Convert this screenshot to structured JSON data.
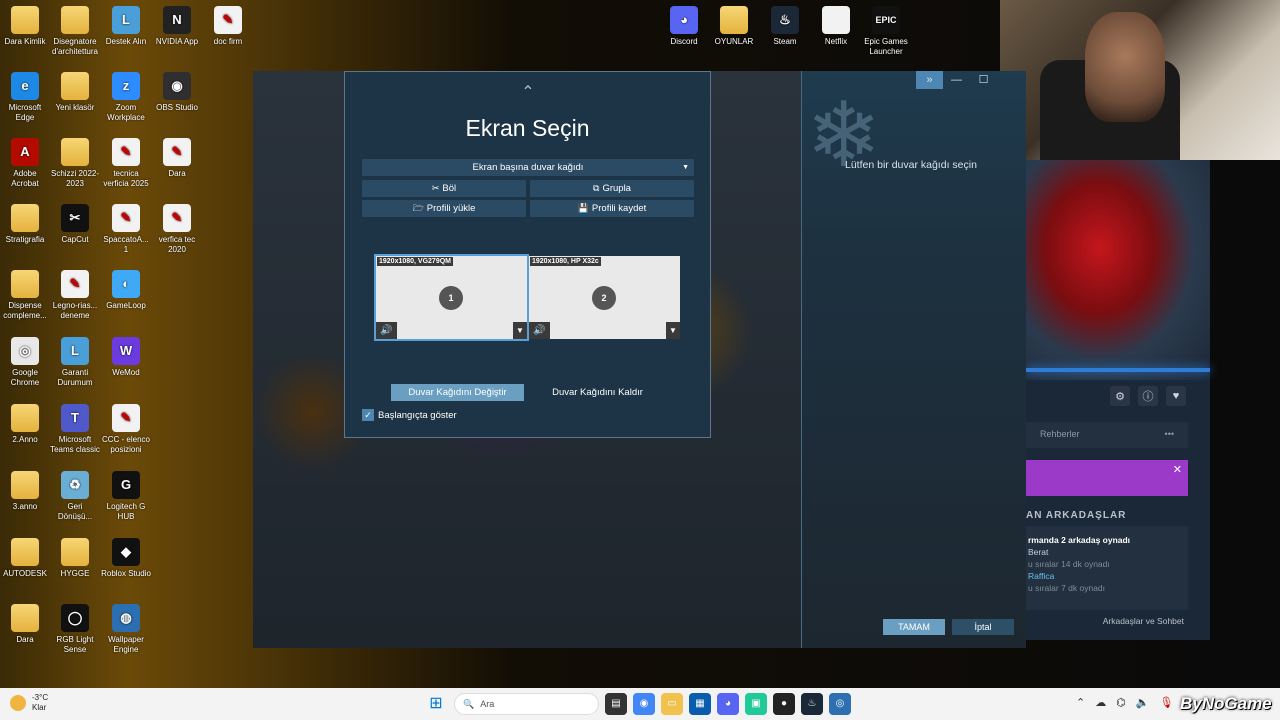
{
  "desktop_icons_left": [
    {
      "label": "Dara Kimlik",
      "icon": "folder-icon",
      "kind": "folder"
    },
    {
      "label": "Disegnatore d'architettura",
      "icon": "folder-icon",
      "kind": "folder"
    },
    {
      "label": "Destek Alın",
      "icon": "support-icon",
      "kind": "app"
    },
    {
      "label": "NVIDIA App",
      "icon": "nvidia-icon",
      "kind": "app"
    },
    {
      "label": "doc firm",
      "icon": "pdf-icon",
      "kind": "pdf"
    },
    {
      "label": "Microsoft Edge",
      "icon": "edge-icon",
      "kind": "app"
    },
    {
      "label": "Yeni klasör",
      "icon": "folder-icon",
      "kind": "folder"
    },
    {
      "label": "Zoom Workplace",
      "icon": "zoom-icon",
      "kind": "app"
    },
    {
      "label": "OBS Studio",
      "icon": "obs-icon",
      "kind": "app"
    },
    {
      "label": "Adobe Acrobat",
      "icon": "acrobat-icon",
      "kind": "app"
    },
    {
      "label": "Schizzi 2022-2023",
      "icon": "folder-icon",
      "kind": "folder"
    },
    {
      "label": "tecnica verficia 2025",
      "icon": "pdf-icon",
      "kind": "pdf"
    },
    {
      "label": "Dara",
      "icon": "pdf-icon",
      "kind": "pdf"
    },
    {
      "label": "Stratigrafia",
      "icon": "folder-icon",
      "kind": "folder"
    },
    {
      "label": "CapCut",
      "icon": "capcut-icon",
      "kind": "app"
    },
    {
      "label": "SpaccatoA... 1",
      "icon": "pdf-icon",
      "kind": "pdf"
    },
    {
      "label": "verfica tec 2020",
      "icon": "pdf-icon",
      "kind": "pdf"
    },
    {
      "label": "Dispense compleme...",
      "icon": "folder-icon",
      "kind": "folder"
    },
    {
      "label": "Legno-rias... deneme",
      "icon": "pdf-icon",
      "kind": "pdf"
    },
    {
      "label": "GameLoop",
      "icon": "gameloop-icon",
      "kind": "app"
    },
    {
      "label": "Google Chrome",
      "icon": "chrome-icon",
      "kind": "app"
    },
    {
      "label": "Garanti Durumum",
      "icon": "support-icon",
      "kind": "app"
    },
    {
      "label": "WeMod",
      "icon": "wemod-icon",
      "kind": "app"
    },
    {
      "label": "2.Anno",
      "icon": "folder-icon",
      "kind": "folder"
    },
    {
      "label": "Microsoft Teams classic",
      "icon": "teams-icon",
      "kind": "app"
    },
    {
      "label": "CCC - elenco posizioni",
      "icon": "pdf-icon",
      "kind": "pdf"
    },
    {
      "label": "3.anno",
      "icon": "folder-icon",
      "kind": "folder"
    },
    {
      "label": "Geri Dönüşü...",
      "icon": "recycle-bin-icon",
      "kind": "app"
    },
    {
      "label": "Logitech G HUB",
      "icon": "logitech-icon",
      "kind": "app"
    },
    {
      "label": "AUTODESK",
      "icon": "folder-icon",
      "kind": "folder"
    },
    {
      "label": "HYGGE",
      "icon": "folder-icon",
      "kind": "folder"
    },
    {
      "label": "Roblox Studio",
      "icon": "roblox-icon",
      "kind": "app"
    },
    {
      "label": "Dara",
      "icon": "folder-icon",
      "kind": "folder"
    },
    {
      "label": "RGB Light Sense",
      "icon": "rgb-icon",
      "kind": "app"
    },
    {
      "label": "Wallpaper Engine",
      "icon": "wallpaper-engine-icon",
      "kind": "app"
    }
  ],
  "desktop_icons_top": [
    {
      "label": "Discord",
      "icon": "discord-icon"
    },
    {
      "label": "OYUNLAR",
      "icon": "folder-icon"
    },
    {
      "label": "Steam",
      "icon": "steam-icon"
    },
    {
      "label": "Netflix",
      "icon": "file-icon"
    },
    {
      "label": "Epic Games Launcher",
      "icon": "epic-icon",
      "logo_text": "EPIC"
    }
  ],
  "dialog": {
    "title": "Ekran Seçin",
    "mode_dropdown": "Ekran başına duvar kağıdı",
    "split_label": "Böl",
    "group_label": "Grupla",
    "load_profile_label": "Profili yükle",
    "save_profile_label": "Profili kaydet",
    "monitors": [
      {
        "label": "1920x1080, VG279QM",
        "number": "1",
        "selected": true
      },
      {
        "label": "1920x1080, HP X32c",
        "number": "2",
        "selected": false
      }
    ],
    "change_wallpaper_label": "Duvar Kağıdını Değiştir",
    "remove_wallpaper_label": "Duvar Kağıdını Kaldır",
    "show_on_startup_label": "Başlangıçta göster",
    "show_on_startup_checked": true
  },
  "right_panel": {
    "hint": "Lütfen bir duvar kağıdı seçin",
    "ok_label": "TAMAM",
    "cancel_label": "İptal"
  },
  "steam": {
    "tab_label": "Rehberler",
    "friends_title": "AN ARKADAŞLAR",
    "friends_summary": "rmanda 2 arkadaş oynadı",
    "friend1_name": "Berat",
    "friend1_status": "u sıralar 14 dk oynadı",
    "friend2_name": "Raffica",
    "friend2_status": "u sıralar 7 dk oynadı",
    "footer": "Arkadaşlar ve Sohbet"
  },
  "taskbar": {
    "weather_temp": "-3°C",
    "weather_desc": "Klar",
    "search_placeholder": "Ara",
    "brand": "ByNoGame"
  }
}
